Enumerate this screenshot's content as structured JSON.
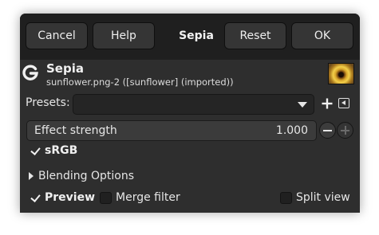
{
  "header": {
    "cancel_label": "Cancel",
    "help_label": "Help",
    "title": "Sepia",
    "reset_label": "Reset",
    "ok_label": "OK"
  },
  "operation": {
    "icon": "gegl-icon",
    "name": "Sepia",
    "subtitle": "sunflower.png-2 ([sunflower] (imported))",
    "thumbnail_icon": "sunflower-thumbnail"
  },
  "presets": {
    "label": "Presets:",
    "value": "",
    "add_icon": "plus-icon",
    "manage_icon": "preset-menu-icon"
  },
  "effect_strength": {
    "label": "Effect strength",
    "value": "1.000",
    "fill_fraction": 1.0
  },
  "srgb": {
    "label": "sRGB",
    "checked": true
  },
  "blending": {
    "label": "Blending Options",
    "expanded": false
  },
  "footer": {
    "preview_label": "Preview",
    "preview_checked": true,
    "merge_label": "Merge filter",
    "merge_checked": false,
    "split_label": "Split view",
    "split_checked": false
  },
  "colors": {
    "dialog_bg": "#2e2e2e",
    "header_bg": "#1f1f1f",
    "text": "#e6e6e6"
  }
}
